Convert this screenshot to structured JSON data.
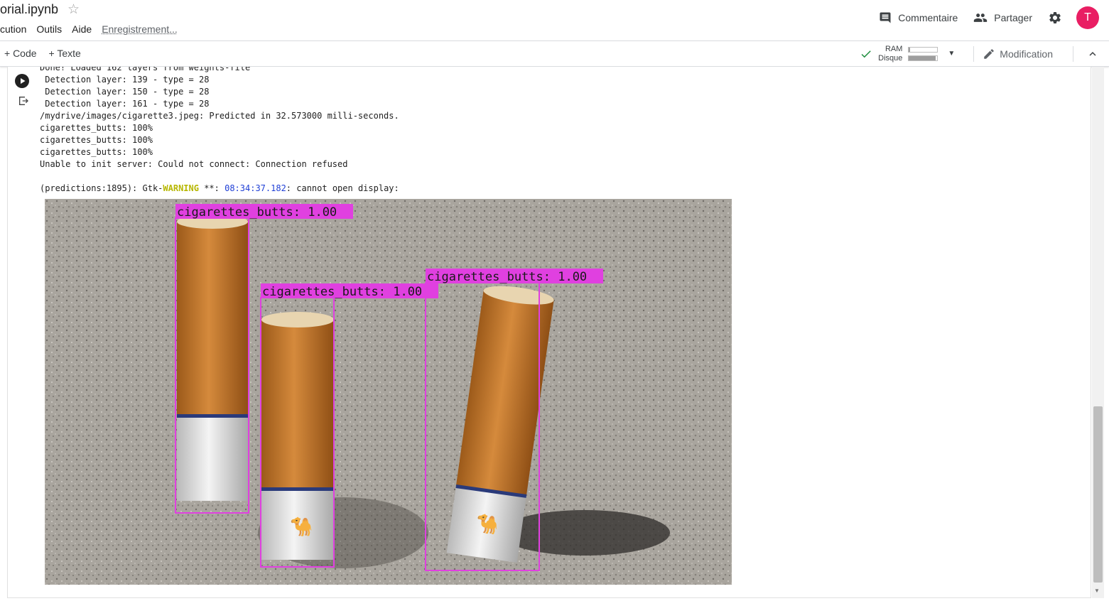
{
  "header": {
    "doc_title": "orial.ipynb",
    "menu": [
      "cution",
      "Outils",
      "Aide"
    ],
    "save_status": "Enregistrement...",
    "comment_label": "Commentaire",
    "share_label": "Partager",
    "avatar_letter": "T"
  },
  "toolbar": {
    "add_code": "+ Code",
    "add_text": "+ Texte",
    "ram_label": "RAM",
    "disk_label": "Disque",
    "ram_level": 0.05,
    "disk_level": 0.95,
    "edit_label": "Modification"
  },
  "output": {
    "lines": [
      "Done! Loaded 162 layers from weights-file",
      " Detection layer: 139 - type = 28",
      " Detection layer: 150 - type = 28",
      " Detection layer: 161 - type = 28",
      "/mydrive/images/cigarette3.jpeg: Predicted in 32.573000 milli-seconds.",
      "cigarettes_butts: 100%",
      "cigarettes_butts: 100%",
      "cigarettes_butts: 100%",
      "Unable to init server: Could not connect: Connection refused",
      ""
    ],
    "warning_prefix": "(predictions:1895): Gtk-",
    "warning_word": "WARNING",
    "warning_mid": " **: ",
    "warning_time": "08:34:37.182",
    "warning_suffix": ": cannot open display:"
  },
  "detections": [
    {
      "label": "cigarettes_butts: 1.00"
    },
    {
      "label": "cigarettes_butts: 1.00"
    },
    {
      "label": "cigarettes_butts: 1.00"
    }
  ],
  "colors": {
    "avatar": "#e91e63",
    "bbox": "#e040e0",
    "check": "#1e8e3e"
  }
}
